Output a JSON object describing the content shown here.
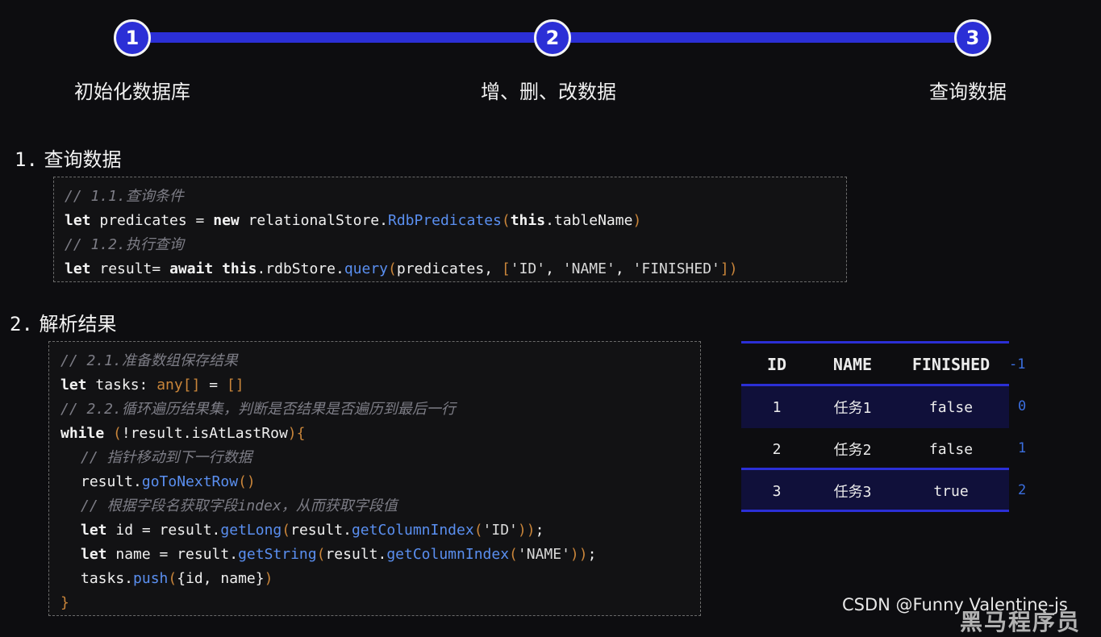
{
  "stepper": {
    "steps": [
      {
        "number": "1",
        "label": "初始化数据库"
      },
      {
        "number": "2",
        "label": "增、删、改数据"
      },
      {
        "number": "3",
        "label": "查询数据"
      }
    ]
  },
  "section1": {
    "number": "1.",
    "title": "查询数据",
    "code": {
      "line1_comment": "// 1.1.查询条件",
      "line2_kw": "let",
      "line2_a": " predicates = ",
      "line2_new": "new",
      "line2_b": " relationalStore.",
      "line2_fn": "RdbPredicates",
      "line2_paren_open": "(",
      "line2_this": "this",
      "line2_c": ".tableName",
      "line2_paren_close": ")",
      "line3_comment": "// 1.2.执行查询",
      "line4_kw": "let",
      "line4_a": " result= ",
      "line4_await": "await",
      "line4_sp": " ",
      "line4_this": "this",
      "line4_b": ".rdbStore.",
      "line4_fn": "query",
      "line4_paren_open": "(",
      "line4_c": "predicates, ",
      "line4_bracket_open": "[",
      "line4_s1": "'ID'",
      "line4_comma1": ", ",
      "line4_s2": "'NAME'",
      "line4_comma2": ", ",
      "line4_s3": "'FINISHED'",
      "line4_bracket_close": "]",
      "line4_paren_close": ")"
    }
  },
  "section2": {
    "number": "2.",
    "title": "解析结果",
    "code": {
      "l1_comment": "// 2.1.准备数组保存结果",
      "l2_kw": "let",
      "l2_a": " tasks: ",
      "l2_type": "any[]",
      "l2_b": " = ",
      "l2_c": "[]",
      "l3_comment": "// 2.2.循环遍历结果集，判断是否结果是否遍历到最后一行",
      "l4_kw": "while",
      "l4_sp": " ",
      "l4_po": "(",
      "l4_a": "!result.isAtLastRow",
      "l4_pc": ")",
      "l4_b": "{",
      "l5_comment": "// 指针移动到下一行数据",
      "l6_a": "result.",
      "l6_fn": "goToNextRow",
      "l6_p": "()",
      "l7_comment": "// 根据字段名获取字段index，从而获取字段值",
      "l8_kw": "let",
      "l8_a": " id = result.",
      "l8_fn": "getLong",
      "l8_po": "(",
      "l8_b": "result.",
      "l8_fn2": "getColumnIndex",
      "l8_po2": "(",
      "l8_s": "'ID'",
      "l8_pc": "))",
      "l8_end": ";",
      "l9_kw": "let",
      "l9_a": " name = result.",
      "l9_fn": "getString",
      "l9_po": "(",
      "l9_b": "result.",
      "l9_fn2": "getColumnIndex",
      "l9_po2": "(",
      "l9_s": "'NAME'",
      "l9_pc": "))",
      "l9_end": ";",
      "l10_a": "tasks.",
      "l10_fn": "push",
      "l10_po": "(",
      "l10_b": "{id, name}",
      "l10_pc": ")",
      "l11": "}"
    }
  },
  "result_table": {
    "headers": [
      "ID",
      "NAME",
      "FINISHED"
    ],
    "header_index": "-1",
    "rows": [
      {
        "id": "1",
        "name": "任务1",
        "finished": "false",
        "index": "0"
      },
      {
        "id": "2",
        "name": "任务2",
        "finished": "false",
        "index": "1"
      },
      {
        "id": "3",
        "name": "任务3",
        "finished": "true",
        "index": "2"
      }
    ],
    "accent_color": "#2b2fd6"
  },
  "watermark": {
    "csdn": "CSDN @Funny Valentine-js",
    "brand": "黑马程序员"
  },
  "colors": {
    "background": "#0d0d10",
    "accent": "#2b2fd6",
    "comment": "#7d7d86",
    "function": "#5a8ff0",
    "type": "#c9853a"
  }
}
